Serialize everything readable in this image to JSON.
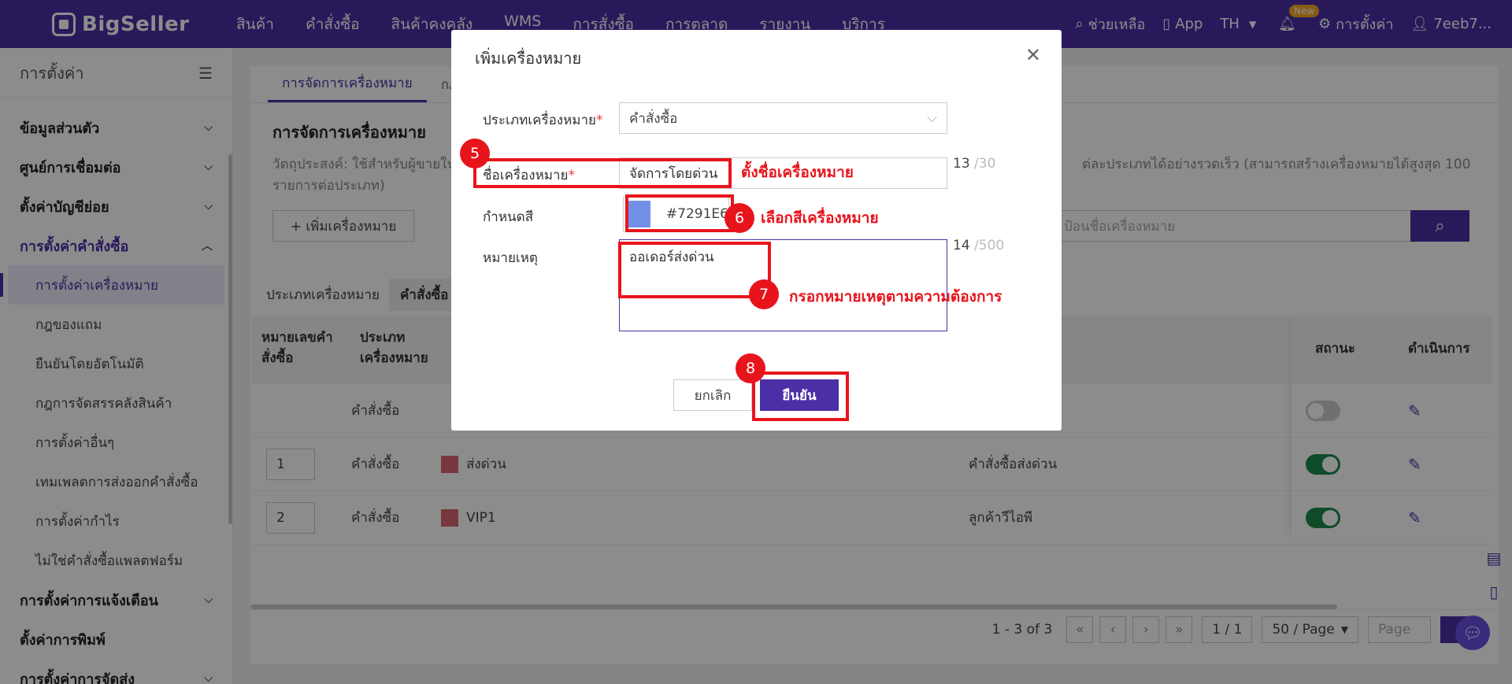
{
  "topnav": {
    "logo": "BigSeller",
    "menu": [
      "สินค้า",
      "คำสั่งซื้อ",
      "สินค้าคงคลัง",
      "WMS",
      "การสั่งซื้อ",
      "การตลาด",
      "รายงาน",
      "บริการ"
    ],
    "help": "ช่วยเหลือ",
    "app": "App",
    "lang": "TH",
    "new_badge": "New",
    "settings": "การตั้งค่า",
    "user": "7eeb7..."
  },
  "sidebar": {
    "title": "การตั้งค่า",
    "groups": {
      "personal": "ข้อมูลส่วนตัว",
      "integration": "ศูนย์การเชื่อมต่อ",
      "account": "ตั้งค่าบัญชีย่อย",
      "order_settings": "การตั้งค่าคำสั่งซื้อ",
      "notification": "การตั้งค่าการแจ้งเตือน",
      "print": "ตั้งค่าการพิมพ์",
      "shipping": "การตั้งค่าการจัดส่ง"
    },
    "subs": {
      "tag_settings": "การตั้งค่าเครื่องหมาย",
      "gift_rules": "กฎของแถม",
      "auto_confirm": "ยืนยันโดยอัตโนมัติ",
      "warehouse_rules": "กฎการจัดสรรคลังสินค้า",
      "other_settings": "การตั้งค่าอื่นๆ",
      "export_template": "เทมเพลตการส่งออกคำสั่งซื้อ",
      "profit_settings": "การตั้งค่ากำไร",
      "non_platform": "ไม่ใช่คำสั่งซื้อแพลตฟอร์ม"
    }
  },
  "main": {
    "tabs": [
      "การจัดการเครื่องหมาย",
      "กฎ"
    ],
    "section_title": "การจัดการเครื่องหมาย",
    "desc_left": "วัตถุประสงค์: ใช้สำหรับผู้ขายใน",
    "desc_right": "ต่ละประเภทได้อย่างรวดเร็ว (สามารถสร้างเครื่องหมายได้สูงสุด 100",
    "desc_line2": "รายการต่อประเภท)",
    "add_button": "+ เพิ่มเครื่องหมาย",
    "search_placeholder": "ป้อนชื่อเครื่องหมาย",
    "filter_label": "ประเภทเครื่องหมาย",
    "filter_chip": "คำสั่งซื้อ",
    "table": {
      "headers": {
        "number": "หมายเลขคำสั่งซื้อ",
        "type": "ประเภทเครื่องหมาย",
        "status": "สถานะ",
        "action": "ดำเนินการ"
      },
      "rows": [
        {
          "number": "",
          "type": "คำสั่งซื้อ",
          "tag": "",
          "remark": "",
          "on": false
        },
        {
          "number": "1",
          "type": "คำสั่งซื้อ",
          "tag": "ส่งด่วน",
          "remark": "คำสั่งซื้อส่งด่วน",
          "on": true
        },
        {
          "number": "2",
          "type": "คำสั่งซื้อ",
          "tag": "VIP1",
          "remark": "ลูกค้าวีไอพี",
          "on": true
        }
      ]
    },
    "pager": {
      "summary": "1 - 3 of 3",
      "page": "1 / 1",
      "page_size": "50 / Page",
      "goto": "Page"
    }
  },
  "modal": {
    "title": "เพิ่มเครื่องหมาย",
    "type_label": "ประเภทเครื่องหมาย",
    "type_value": "คำสั่งซื้อ",
    "name_label": "ชื่อเครื่องหมาย",
    "name_value": "จัดการโดยด่วน",
    "name_count": "13",
    "name_max": "/30",
    "color_label": "กำหนดสี",
    "color_value": "#7291E6",
    "remark_label": "หมายเหตุ",
    "remark_value": "ออเดอร์ส่งด่วน",
    "remark_count": "14",
    "remark_max": "/500",
    "cancel": "ยกเลิก",
    "confirm": "ยืนยัน"
  },
  "annotations": {
    "step5": "5",
    "step5_text": "ตั้งชื่อเครื่องหมาย",
    "step6": "6",
    "step6_text": "เลือกสีเครื่องหมาย",
    "step7": "7",
    "step7_text": "กรอกหมายเหตุตามความต้องการ",
    "step8": "8"
  },
  "colors": {
    "brand": "#4b2fa6",
    "annotation": "#e8141c",
    "tag_color": "#7291e6"
  }
}
